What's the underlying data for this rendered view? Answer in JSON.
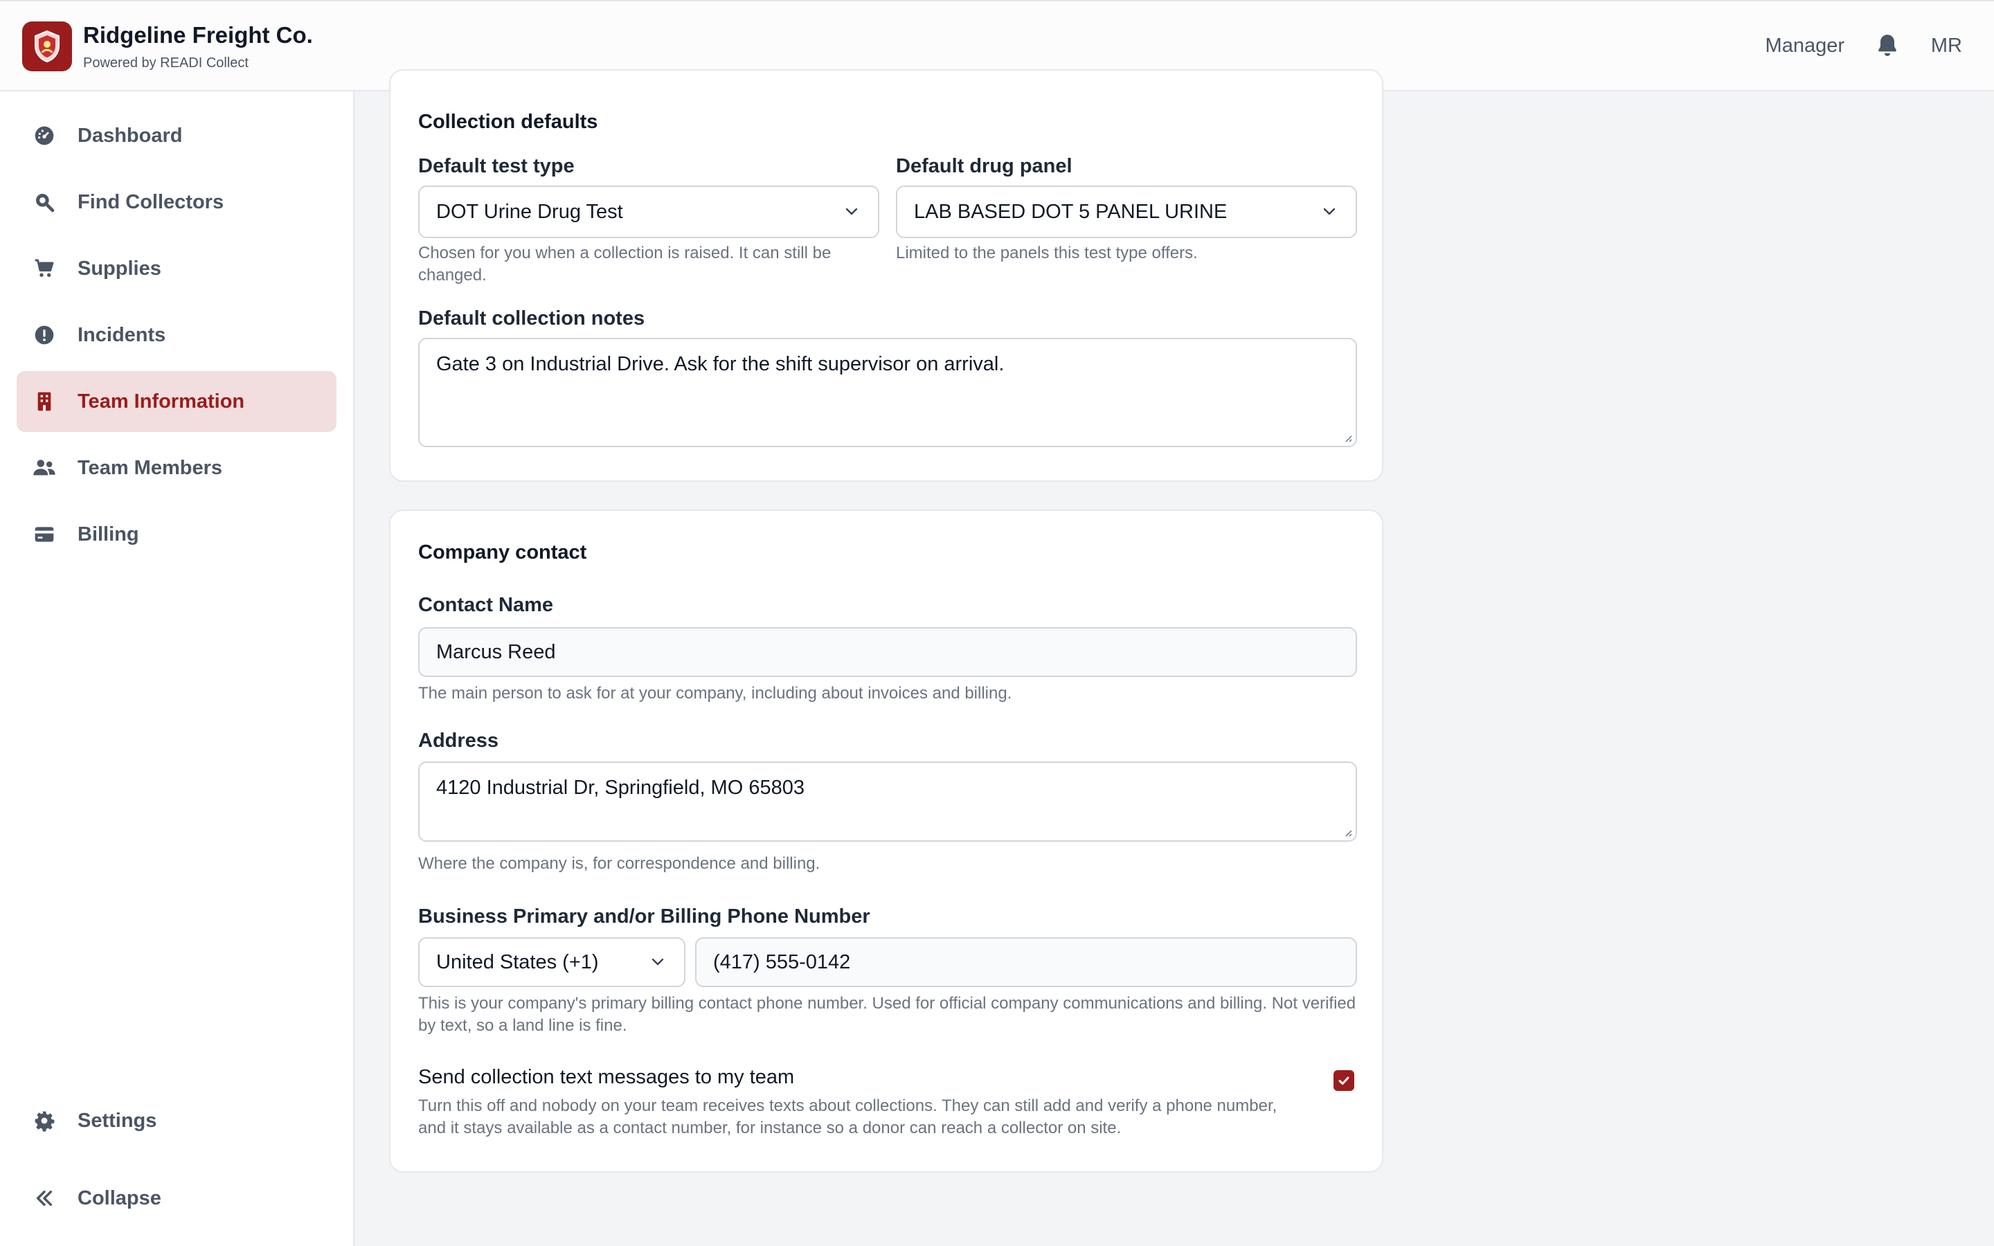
{
  "header": {
    "brand_name": "Ridgeline Freight Co.",
    "brand_sub": "Powered by READI Collect",
    "role": "Manager",
    "initials": "MR",
    "icons": {
      "logo": "shield-icon",
      "notifications": "bell-icon"
    }
  },
  "sidebar": {
    "items": [
      {
        "label": "Dashboard",
        "icon": "gauge-icon",
        "active": false
      },
      {
        "label": "Find Collectors",
        "icon": "search-icon",
        "active": false
      },
      {
        "label": "Supplies",
        "icon": "cart-icon",
        "active": false
      },
      {
        "label": "Incidents",
        "icon": "alert-icon",
        "active": false
      },
      {
        "label": "Team Information",
        "icon": "building-icon",
        "active": true
      },
      {
        "label": "Team Members",
        "icon": "users-icon",
        "active": false
      },
      {
        "label": "Billing",
        "icon": "credit-card-icon",
        "active": false
      }
    ],
    "footer": [
      {
        "label": "Settings",
        "icon": "gear-icon"
      },
      {
        "label": "Collapse",
        "icon": "chevrons-left-icon"
      }
    ]
  },
  "collection_defaults": {
    "title": "Collection defaults",
    "test_type": {
      "label": "Default test type",
      "value": "DOT Urine Drug Test",
      "help": "Chosen for you when a collection is raised. It can still be changed."
    },
    "drug_panel": {
      "label": "Default drug panel",
      "value": "LAB BASED DOT 5 PANEL URINE",
      "help": "Limited to the panels this test type offers."
    },
    "notes": {
      "label": "Default collection notes",
      "value": "Gate 3 on Industrial Drive. Ask for the shift supervisor on arrival."
    }
  },
  "company_contact": {
    "title": "Company contact",
    "contact_name": {
      "label": "Contact Name",
      "value": "Marcus Reed",
      "help": "The main person to ask for at your company, including about invoices and billing."
    },
    "address": {
      "label": "Address",
      "value": "4120 Industrial Dr, Springfield, MO 65803",
      "help": "Where the company is, for correspondence and billing."
    },
    "phone": {
      "label": "Business Primary and/or Billing Phone Number",
      "country": "United States (+1)",
      "number": "(417) 555-0142",
      "help": "This is your company's primary billing contact phone number. Used for official company communications and billing. Not verified by text, so a land line is fine."
    },
    "sms": {
      "label": "Send collection text messages to my team",
      "checked": true,
      "help": "Turn this off and nobody on your team receives texts about collections. They can still add and verify a phone number, and it stays available as a contact number, for instance so a donor can reach a collector on site."
    }
  },
  "colors": {
    "brand": "#9b1c1c",
    "active_bg": "#f2dede",
    "text_muted": "#6b7280",
    "border": "#e5e7eb"
  }
}
